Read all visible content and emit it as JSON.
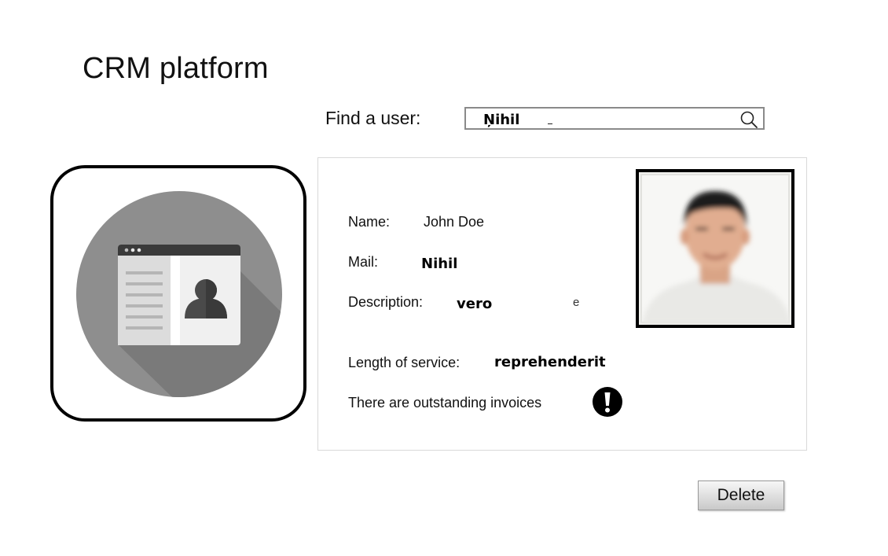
{
  "header": {
    "title": "CRM platform"
  },
  "search": {
    "label": "Find a user:",
    "value": "Ņihil",
    "icon": "search-icon"
  },
  "avatar": {
    "icon": "contact-card-icon",
    "circle_color": "#8c8c8c"
  },
  "profile": {
    "name_label": "Name:",
    "name_value": "John Doe",
    "mail_label": "Mail:",
    "mail_value": "Nihil",
    "description_label": "Description:",
    "description_value": "vero",
    "description_trailing": "e",
    "service_label": "Length of service:",
    "service_value": "reprehenderit",
    "invoice_notice": "There are outstanding invoices",
    "warning_icon": "exclamation-icon",
    "photo": "user-photo"
  },
  "actions": {
    "delete_label": "Delete"
  }
}
